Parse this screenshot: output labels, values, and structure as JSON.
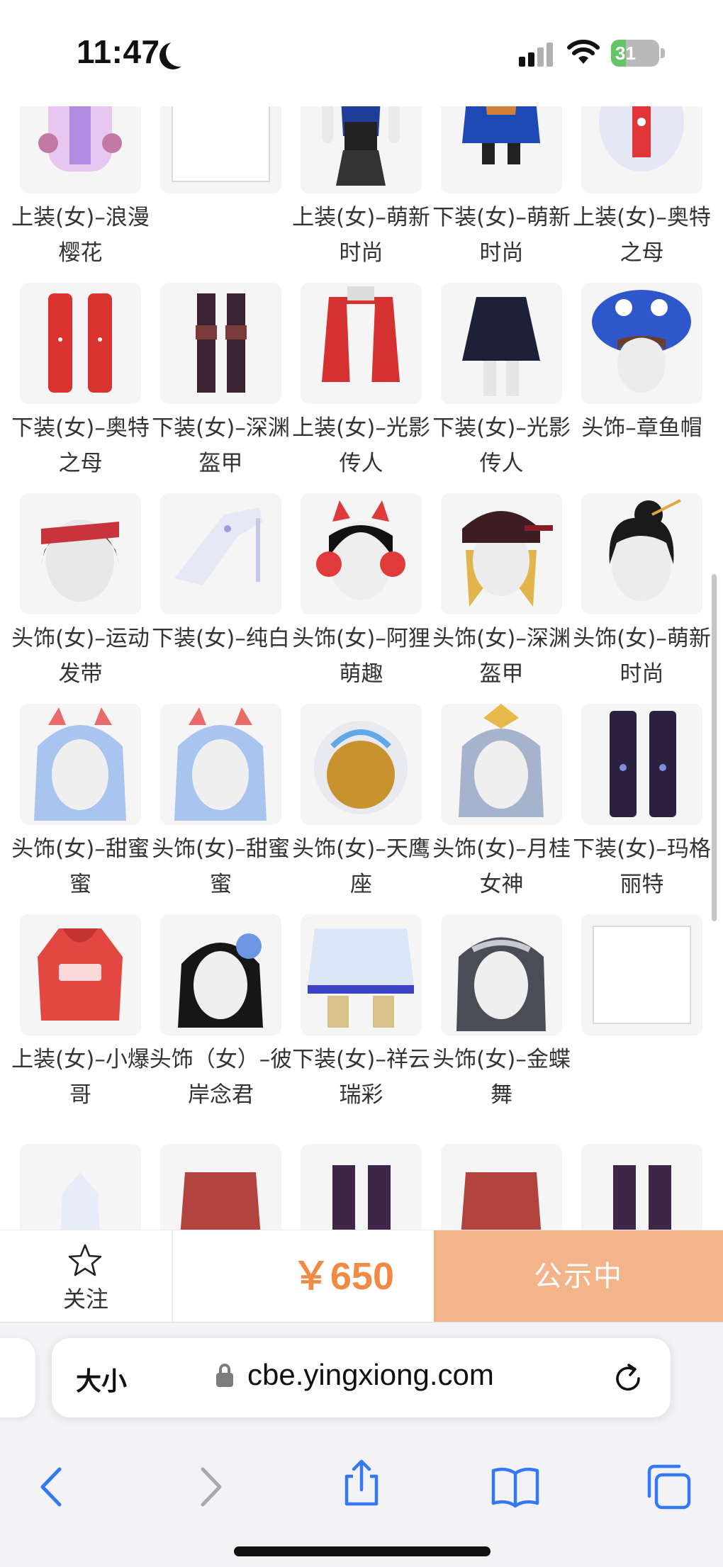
{
  "status_bar": {
    "time": "11:47",
    "battery_level": "31",
    "battery_fraction": 0.31,
    "icons": [
      "moon-icon",
      "signal-icon",
      "wifi-icon",
      "battery-icon"
    ]
  },
  "grid": {
    "rows": [
      [
        {
          "label": "上装(女)–浪漫樱花",
          "thumb": "pink-dress"
        },
        {
          "label": "",
          "thumb": "empty"
        },
        {
          "label": "上装(女)–萌新时尚",
          "thumb": "blue-corset"
        },
        {
          "label": "下装(女)–萌新时尚",
          "thumb": "blue-skirt"
        },
        {
          "label": "上装(女)–奥特之母",
          "thumb": "red-white-top"
        }
      ],
      [
        {
          "label": "下装(女)–奥特之母",
          "thumb": "red-boots"
        },
        {
          "label": "下装(女)–深渊盔甲",
          "thumb": "dark-boots"
        },
        {
          "label": "上装(女)–光影传人",
          "thumb": "red-jacket"
        },
        {
          "label": "下装(女)–光影传人",
          "thumb": "navy-skirt"
        },
        {
          "label": "头饰–章鱼帽",
          "thumb": "octopus-hat"
        }
      ],
      [
        {
          "label": "头饰(女)–运动发带",
          "thumb": "headband"
        },
        {
          "label": "下装(女)–纯白",
          "thumb": "white-heel"
        },
        {
          "label": "头饰(女)–阿狸萌趣",
          "thumb": "cat-headphones"
        },
        {
          "label": "头饰(女)–深渊盔甲",
          "thumb": "blonde-hat"
        },
        {
          "label": "头饰(女)–萌新时尚",
          "thumb": "black-bun"
        }
      ],
      [
        {
          "label": "头饰(女)–甜蜜蜜",
          "thumb": "blue-hair-ears"
        },
        {
          "label": "头饰(女)–甜蜜蜜",
          "thumb": "blue-hair-ears"
        },
        {
          "label": "头饰(女)–天鹰座",
          "thumb": "gold-helmet"
        },
        {
          "label": "头饰(女)–月桂女神",
          "thumb": "silver-hair"
        },
        {
          "label": "下装(女)–玛格丽特",
          "thumb": "purple-boots"
        }
      ],
      [
        {
          "label": "上装(女)–小爆哥",
          "thumb": "red-hoodie"
        },
        {
          "label": "头饰（女）–彼岸念君",
          "thumb": "black-hair-flower"
        },
        {
          "label": "下装(女)–祥云瑞彩",
          "thumb": "white-skirt"
        },
        {
          "label": "头饰(女)–金蝶舞",
          "thumb": "dark-hair-jewel"
        },
        {
          "label": "",
          "thumb": "empty"
        }
      ],
      [
        {
          "label": "",
          "thumb": "partial-white"
        },
        {
          "label": "",
          "thumb": "partial-red"
        },
        {
          "label": "",
          "thumb": "partial-purple"
        },
        {
          "label": "",
          "thumb": "partial-red"
        },
        {
          "label": "",
          "thumb": "partial-purple"
        }
      ]
    ]
  },
  "action_bar": {
    "follow_label": "关注",
    "price": "￥650",
    "status_button": "公示中"
  },
  "browser": {
    "text_size_label": "大小",
    "url": "cbe.yingxiong.com"
  },
  "colors": {
    "price": "#f08a45",
    "status_button_bg": "#f3b48a",
    "battery_green": "#65c466",
    "safari_blue": "#3478f6"
  }
}
